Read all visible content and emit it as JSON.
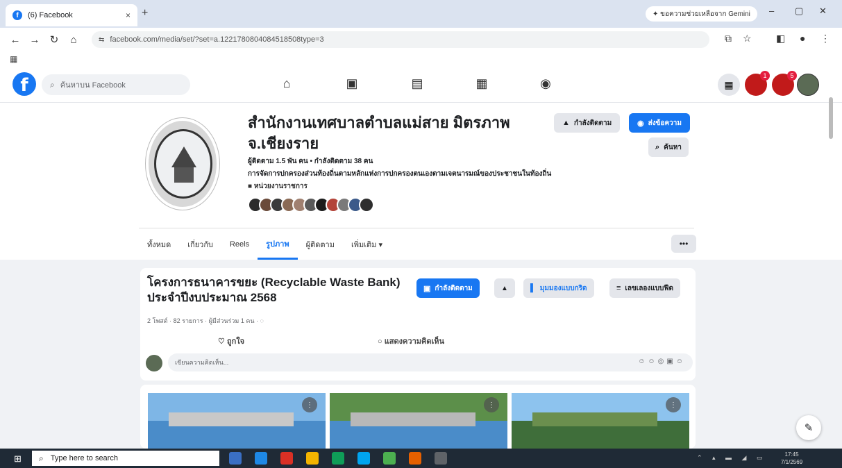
{
  "browser": {
    "tab_title": "(6) Facebook",
    "tab_favicon": "f",
    "tab_close": "×",
    "new_tab": "+",
    "gemini_label": "✦ ขอความช่วยเหลือจาก Gemini",
    "url": "facebook.com/media/set/?set=a.1221780804084518508type=3",
    "url_icon": "⇆",
    "nav": {
      "back": "←",
      "forward": "→",
      "reload": "↻",
      "home": "⌂"
    },
    "window": {
      "minimize": "–",
      "maximize": "▢",
      "close": "✕"
    },
    "right_icons": {
      "cast": "⧉",
      "star": "☆",
      "sidepanel": "◧",
      "profile": "●",
      "menu": "⋮"
    },
    "apps_icon": "▦"
  },
  "fb": {
    "logo": "f",
    "search_placeholder": "ค้นหาบน Facebook",
    "search_icon": "⌕",
    "nav_icons": {
      "home": "⌂",
      "video": "▣",
      "marketplace": "▤",
      "store": "▦",
      "gaming": "◉"
    },
    "menu_icon": "▦",
    "messenger_badge": "1",
    "notif_badge": "5"
  },
  "page": {
    "name": "สำนักงานเทศบาลตำบลแม่สาย มิตรภาพ จ.เชียงราย",
    "followers": "ผู้ติดตาม 1.5 พัน คน • กำลังติดตาม 38 คน",
    "description": "การจัดการปกครองส่วนท้องถิ่นตามหลักแห่งการปกครองตนเองตามเจตนารมณ์ของประชาชนในท้องถิ่น",
    "category": "■ หน่วยงานราชการ",
    "following_btn": "กำลังติดตาม",
    "message_btn": "ส่งข้อความ",
    "search_btn": "ค้นหา",
    "following_icon": "▲",
    "message_icon": "◉",
    "search_icon": "⌕",
    "tabs": [
      "ทั้งหมด",
      "เกี่ยวกับ",
      "Reels",
      "รูปภาพ",
      "ผู้ติดตาม",
      "เพิ่มเติม ▾"
    ],
    "more_label": "•••",
    "face_colors": [
      "#2b2b2b",
      "#6a4a3a",
      "#3a3a3a",
      "#8a6a55",
      "#a08070",
      "#5a5a5a",
      "#1c1c1c",
      "#b3443a",
      "#7a7a7a",
      "#3b5a8a",
      "#2e2e2e"
    ]
  },
  "album": {
    "title": "โครงการธนาคารขยะ (Recyclable Waste Bank) ประจำปีงบประมาณ 2568",
    "follow_btn": "กำลังติดตาม",
    "follow_icon": "▣",
    "bell_icon": "▲",
    "grid_btn": "มุมมองแบบกริด",
    "grid_icon": "▌",
    "list_btn": "เลขเลองแบบฟีด",
    "list_icon": "≡",
    "meta": "2 โพสต์ · 82 รายการ · ผู้มีส่วนร่วม 1 คน · ◌",
    "like": "ถูกใจ",
    "like_icon": "♡",
    "comment": "แสดงความคิดเห็น",
    "comment_icon": "○",
    "comment_placeholder": "เขียนความคิดเห็น...",
    "comment_tools": "☺☺◎▣☺",
    "photo_badge": "⋮"
  },
  "fab_icon": "✎",
  "taskbar": {
    "start": "⊞",
    "search_placeholder": "Type here to search",
    "search_icon": "⌕",
    "icon_colors": [
      "#3a6fc4",
      "#1e88e5",
      "#d93025",
      "#f4b400",
      "#0f9d58",
      "#00a4ef",
      "#4caf50",
      "#e66000",
      "#5f6368"
    ],
    "tray": "⌃ ▴ ▬ ◢ ▭",
    "time": "17:45",
    "date": "7/1/2569"
  }
}
